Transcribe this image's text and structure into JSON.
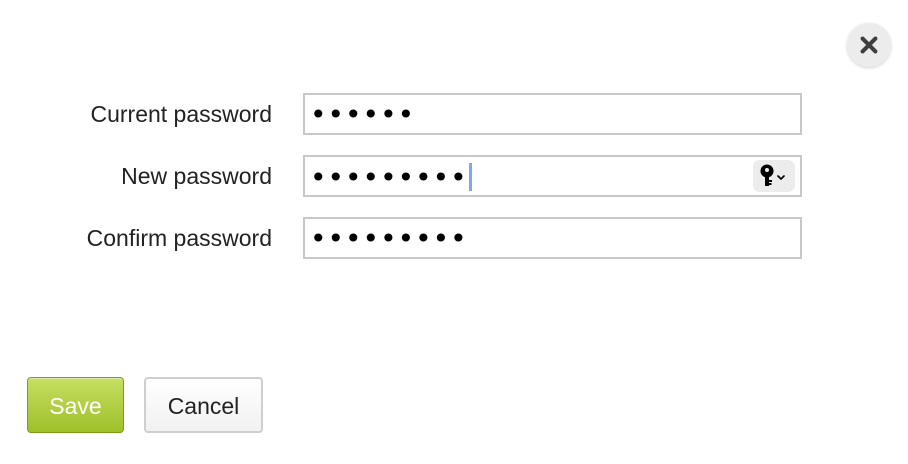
{
  "dialog": {
    "close_icon": "close-icon"
  },
  "form": {
    "current_password": {
      "label": "Current password",
      "value": "••••••"
    },
    "new_password": {
      "label": "New password",
      "value": "•••••••••",
      "key_icon": "key-icon",
      "dropdown_icon": "chevron-down-icon"
    },
    "confirm_password": {
      "label": "Confirm password",
      "value": "•••••••••"
    }
  },
  "actions": {
    "save_label": "Save",
    "cancel_label": "Cancel"
  },
  "colors": {
    "save_button": "#a8c73a",
    "input_border": "#c8c8c8",
    "text": "#222222",
    "caret": "#7ea6f5"
  }
}
